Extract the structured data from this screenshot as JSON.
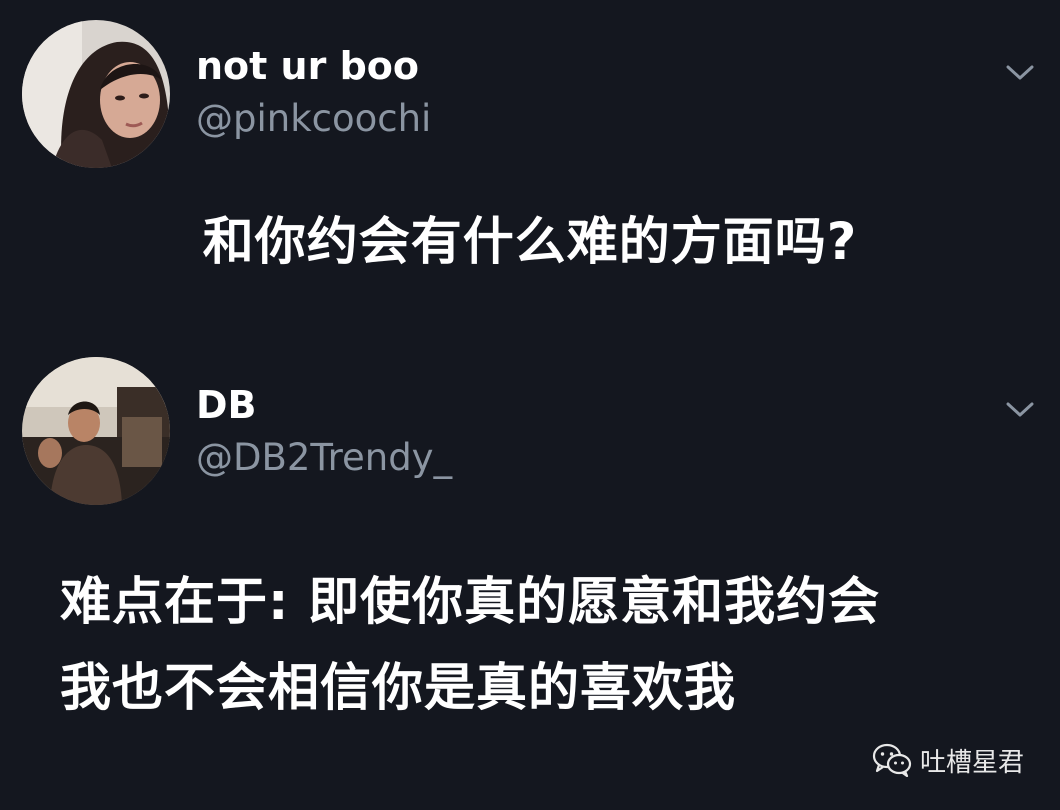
{
  "tweets": [
    {
      "display_name": "not ur boo",
      "handle": "@pinkcoochi",
      "text": "和你约会有什么难的方面吗?",
      "avatar_icon": "profile-photo-woman",
      "menu_icon": "chevron-down-icon"
    },
    {
      "display_name": "DB",
      "handle": "@DB2Trendy_",
      "text_lines": [
        "难点在于: 即使你真的愿意和我约会",
        "我也不会相信你是真的喜欢我"
      ],
      "avatar_icon": "profile-photo-man",
      "menu_icon": "chevron-down-icon"
    }
  ],
  "watermark": {
    "label": "吐槽星君",
    "icon": "wechat-icon"
  },
  "colors": {
    "background": "#14171f",
    "text_primary": "#ffffff",
    "text_secondary": "#8b95a2"
  }
}
